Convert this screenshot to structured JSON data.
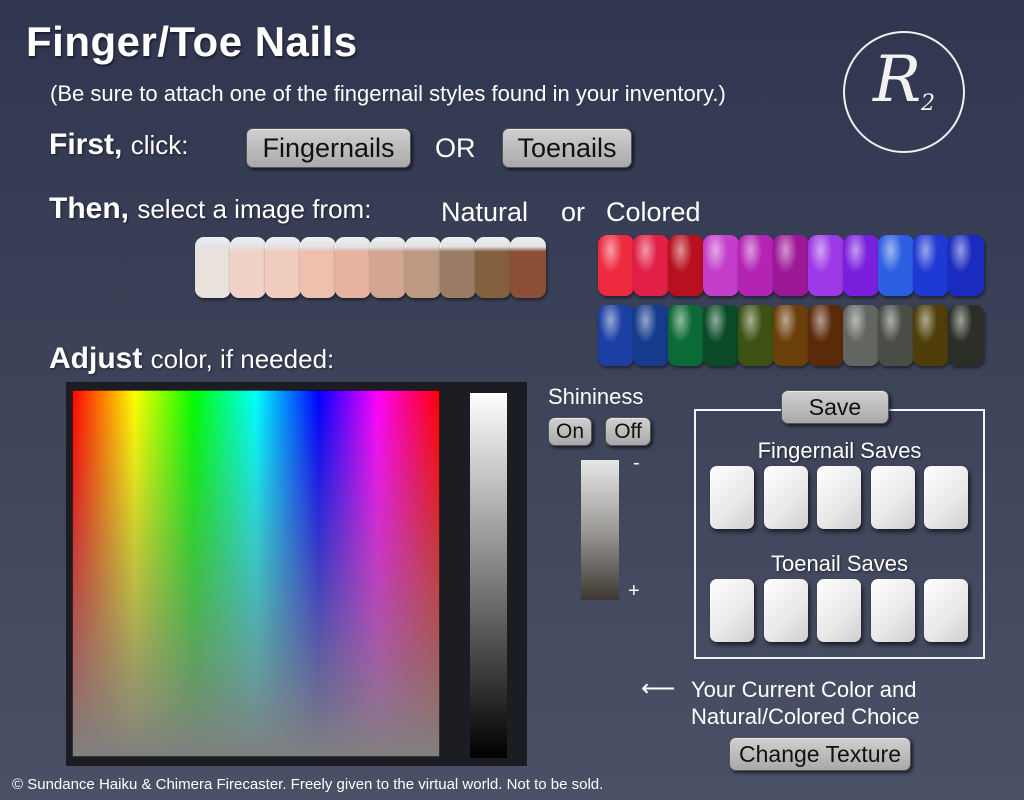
{
  "header": {
    "title": "Finger/Toe Nails",
    "subtitle": "(Be sure to attach one of the fingernail styles found in your inventory.)",
    "logo_letter": "R",
    "logo_sub": "2"
  },
  "step1": {
    "bold": "First,",
    "rest": "click:",
    "fingernails_label": "Fingernails",
    "or_label": "OR",
    "toenails_label": "Toenails"
  },
  "step2": {
    "bold": "Then,",
    "rest": "select a image from:",
    "natural_label": "Natural",
    "or_label": "or",
    "colored_label": "Colored"
  },
  "swatches": {
    "natural": [
      "#e9e2dc",
      "#f1d2c6",
      "#f0ccbe",
      "#efc0ad",
      "#e6b3a1",
      "#d2a692",
      "#bc9980",
      "#9c7c66",
      "#84603f",
      "#8a4f36"
    ],
    "colored_row1": [
      "#ee2a3f",
      "#e21f47",
      "#b8101e",
      "#c43ecb",
      "#b324b4",
      "#9d1897",
      "#9d3ae8",
      "#7a20dd",
      "#2d5fe3",
      "#1f39d4",
      "#1a2bbf"
    ],
    "colored_row2": [
      "#1b3fa2",
      "#143b8c",
      "#0b6a35",
      "#0a4a26",
      "#3d5212",
      "#6b3f0a",
      "#5b2a0b",
      "#636660",
      "#4a4d46",
      "#4f3e08",
      "#2b2f27"
    ]
  },
  "step3": {
    "bold": "Adjust",
    "rest": "color, if needed:"
  },
  "shininess": {
    "label": "Shininess",
    "on_label": "On",
    "off_label": "Off",
    "minus_label": "-",
    "plus_label": "+"
  },
  "saves": {
    "save_button": "Save",
    "fingernail_label": "Fingernail Saves",
    "toenail_label": "Toenail Saves",
    "slot_count_per_row": 5
  },
  "current": {
    "arrow": "⟵",
    "line1": "Your Current Color and",
    "line2": "Natural/Colored Choice",
    "change_texture_label": "Change Texture"
  },
  "footer": {
    "text": "© Sundance Haiku & Chimera Firecaster.  Freely given to the virtual world.  Not to be sold."
  }
}
